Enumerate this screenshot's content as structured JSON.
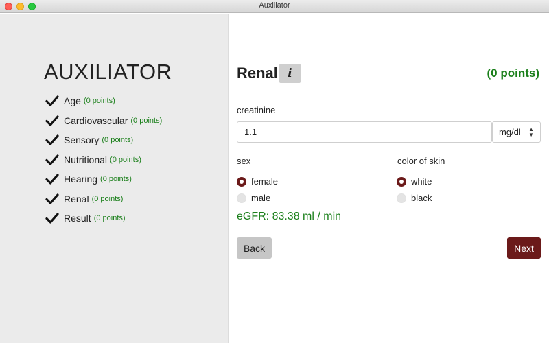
{
  "window": {
    "title": "Auxiliator"
  },
  "sidebar": {
    "app_title": "AUXILIATOR",
    "items": [
      {
        "label": "Age",
        "points": "(0 points)",
        "completed": true
      },
      {
        "label": "Cardiovascular",
        "points": "(0 points)",
        "completed": true
      },
      {
        "label": "Sensory",
        "points": "(0 points)",
        "completed": true
      },
      {
        "label": "Nutritional",
        "points": "(0 points)",
        "completed": true
      },
      {
        "label": "Hearing",
        "points": "(0 points)",
        "completed": true
      },
      {
        "label": "Renal",
        "points": "(0 points)",
        "completed": true
      },
      {
        "label": "Result",
        "points": "(0 points)",
        "completed": true
      }
    ]
  },
  "main": {
    "section_title": "Renal",
    "info_button": "i",
    "points_total": "(0 points)",
    "creatinine": {
      "label": "creatinine",
      "value": "1.1",
      "unit": "mg/dl"
    },
    "sex": {
      "label": "sex",
      "options": [
        {
          "label": "female",
          "selected": true
        },
        {
          "label": "male",
          "selected": false
        }
      ]
    },
    "skin": {
      "label": "color of skin",
      "options": [
        {
          "label": "white",
          "selected": true
        },
        {
          "label": "black",
          "selected": false
        }
      ]
    },
    "egfr": "eGFR: 83.38 ml / min",
    "back_label": "Back",
    "next_label": "Next"
  },
  "colors": {
    "accent": "#6b1a1a",
    "points_green": "#1a7f1a",
    "sidebar_bg": "#ebebeb"
  },
  "icons": {
    "check": "check-icon",
    "info": "info-icon",
    "select_arrows": "up-down-chevron-icon"
  }
}
